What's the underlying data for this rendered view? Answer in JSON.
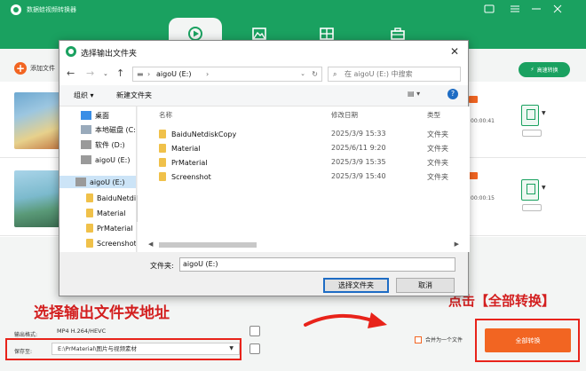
{
  "app": {
    "title": "数据蛙视频转换器",
    "add_file_label": "添加文件",
    "hd_convert_label": "高速转换",
    "rows": [
      {
        "meta_top": "00:00:41",
        "settings_label": "设置"
      },
      {
        "meta_top": "00:00:15",
        "settings_label": "设置"
      }
    ],
    "output_format_label": "输出格式:",
    "output_format_value": "MP4 H.264/HEVC",
    "save_to_label": "保存至:",
    "save_to_value": "E:\\PrMaterial\\图片与视频素材",
    "merge_label": "合并为一个文件",
    "convert_all_label": "全部转换"
  },
  "dialog": {
    "title": "选择输出文件夹",
    "path_segments": [
      "aigoU (E:)"
    ],
    "search_placeholder": "在 aigoU (E:) 中搜索",
    "organize_label": "组织 ▾",
    "new_folder_label": "新建文件夹",
    "nav_items": [
      {
        "label": "桌面"
      },
      {
        "label": "本地磁盘 (C:)"
      },
      {
        "label": "软件 (D:)"
      },
      {
        "label": "aigoU (E:)"
      },
      {
        "label": "aigoU (E:)"
      },
      {
        "label": "BaiduNetdisk"
      },
      {
        "label": "Material"
      },
      {
        "label": "PrMaterial"
      },
      {
        "label": "Screenshot"
      }
    ],
    "columns": {
      "name": "名称",
      "date": "修改日期",
      "type": "类型"
    },
    "files": [
      {
        "name": "BaiduNetdiskCopy",
        "date": "2025/3/9 15:33",
        "type": "文件夹"
      },
      {
        "name": "Material",
        "date": "2025/6/11 9:20",
        "type": "文件夹"
      },
      {
        "name": "PrMaterial",
        "date": "2025/3/9 15:35",
        "type": "文件夹"
      },
      {
        "name": "Screenshot",
        "date": "2025/3/9 15:40",
        "type": "文件夹"
      }
    ],
    "folder_label": "文件夹:",
    "folder_value": "aigoU (E:)",
    "select_label": "选择文件夹",
    "cancel_label": "取消"
  },
  "annotations": {
    "left": "选择输出文件夹地址",
    "right": "点击【全部转换】"
  },
  "colors": {
    "brand_green": "#1aa160",
    "accent_orange": "#f26522",
    "annotation_red": "#d31f1f"
  }
}
